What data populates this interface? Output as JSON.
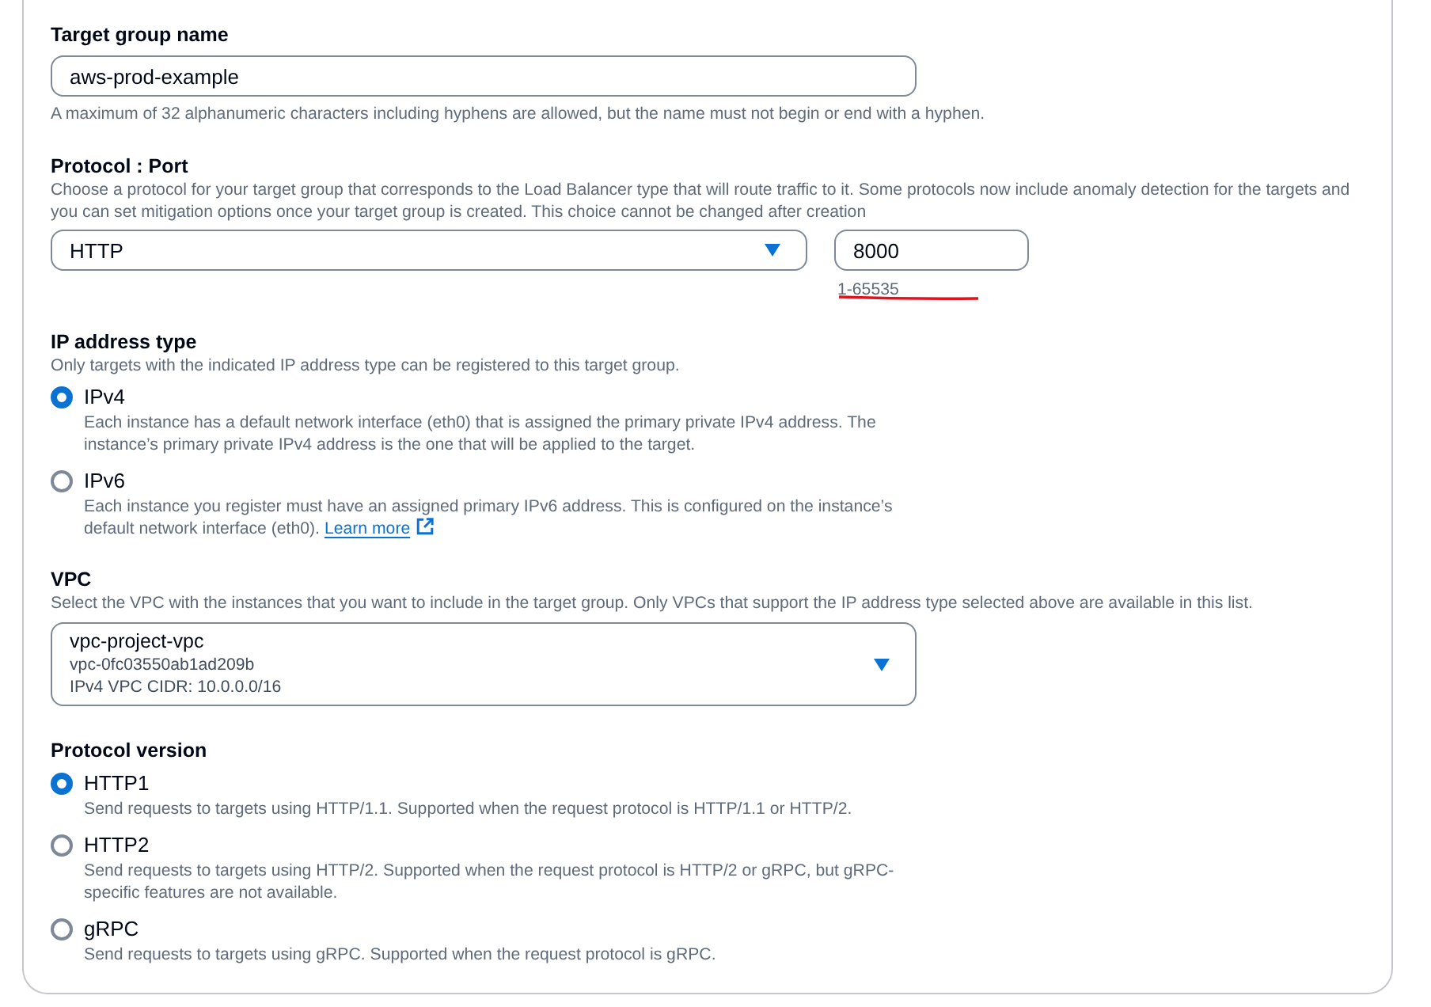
{
  "target_group_name": {
    "label": "Target group name",
    "value": "aws-prod-example",
    "hint": "A maximum of 32 alphanumeric characters including hyphens are allowed, but the name must not begin or end with a hyphen."
  },
  "protocol_port": {
    "label": "Protocol : Port",
    "description": "Choose a protocol for your target group that corresponds to the Load Balancer type that will route traffic to it. Some protocols now include anomaly detection for the targets and you can set mitigation options once your target group is created. This choice cannot be changed after creation",
    "protocol": {
      "value": "HTTP"
    },
    "port": {
      "value": "8000",
      "hint": "1-65535",
      "underlined": true
    }
  },
  "ip_address_type": {
    "label": "IP address type",
    "description": "Only targets with the indicated IP address type can be registered to this target group.",
    "options": [
      {
        "label": "IPv4",
        "description": "Each instance has a default network interface (eth0) that is assigned the primary private IPv4 address. The instance’s primary private IPv4 address is the one that will be applied to the target.",
        "selected": true
      },
      {
        "label": "IPv6",
        "description": "Each instance you register must have an assigned primary IPv6 address. This is configured on the instance’s default network interface (eth0).",
        "link": "Learn more",
        "selected": false
      }
    ]
  },
  "vpc": {
    "label": "VPC",
    "description": "Select the VPC with the instances that you want to include in the target group. Only VPCs that support the IP address type selected above are available in this list.",
    "select": {
      "name": "vpc-project-vpc",
      "id": "vpc-0fc03550ab1ad209b",
      "cidr": "IPv4 VPC CIDR: 10.0.0.0/16"
    }
  },
  "protocol_version": {
    "label": "Protocol version",
    "options": [
      {
        "label": "HTTP1",
        "description": "Send requests to targets using HTTP/1.1. Supported when the request protocol is HTTP/1.1 or HTTP/2.",
        "selected": true
      },
      {
        "label": "HTTP2",
        "description": "Send requests to targets using HTTP/2. Supported when the request protocol is HTTP/2 or gRPC, but gRPC-specific features are not available.",
        "selected": false
      },
      {
        "label": "gRPC",
        "description": "Send requests to targets using gRPC. Supported when the request protocol is gRPC.",
        "selected": false
      }
    ]
  }
}
